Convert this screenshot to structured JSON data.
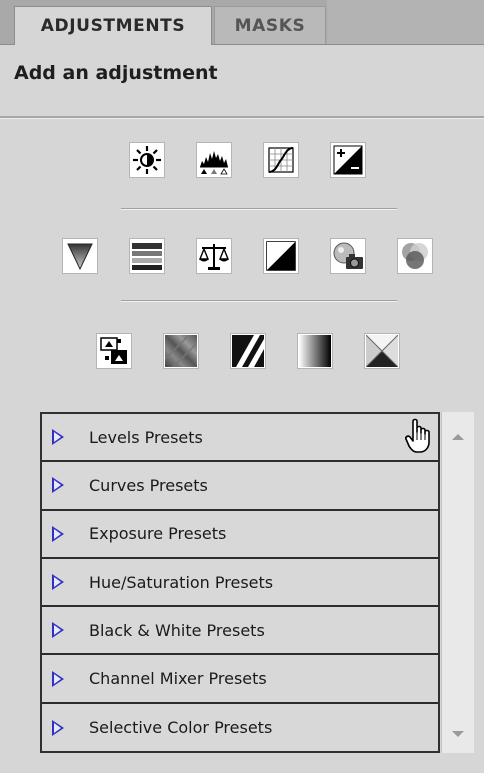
{
  "tabs": [
    {
      "label": "ADJUSTMENTS",
      "active": true
    },
    {
      "label": "MASKS",
      "active": false
    }
  ],
  "heading": "Add an adjustment",
  "icon_rows": [
    [
      "brightness-contrast-icon",
      "levels-icon",
      "curves-icon",
      "exposure-icon"
    ],
    [
      "vibrance-icon",
      "hue-saturation-icon",
      "color-balance-icon",
      "black-white-icon",
      "photo-filter-icon",
      "channel-mixer-icon"
    ],
    [
      "invert-icon",
      "posterize-icon",
      "threshold-icon",
      "gradient-map-icon",
      "selective-color-icon"
    ]
  ],
  "presets": [
    {
      "label": "Levels Presets"
    },
    {
      "label": "Curves Presets"
    },
    {
      "label": "Exposure Presets"
    },
    {
      "label": "Hue/Saturation Presets"
    },
    {
      "label": "Black & White Presets"
    },
    {
      "label": "Channel Mixer Presets"
    },
    {
      "label": "Selective Color Presets"
    }
  ],
  "colors": {
    "panel_bg": "#d6d6d6",
    "disclosure_triangle": "#3030c8"
  }
}
